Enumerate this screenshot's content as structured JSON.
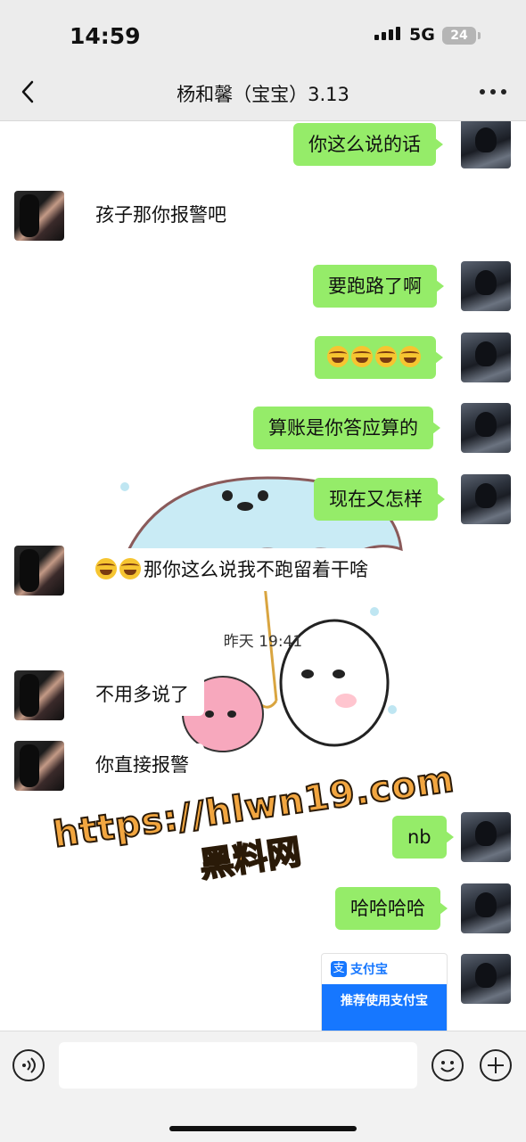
{
  "status_bar": {
    "time": "14:59",
    "network": "5G",
    "battery": "24"
  },
  "header": {
    "title": "杨和馨（宝宝）3.13",
    "back_icon": "chevron-left-icon",
    "more_icon": "more-dots-icon"
  },
  "messages": [
    {
      "side": "right",
      "text": "你这么说的话"
    },
    {
      "side": "left",
      "text": "孩子那你报警吧"
    },
    {
      "side": "right",
      "text": "要跑路了啊"
    },
    {
      "side": "right",
      "emoji_count": 4,
      "emoji": "laugh-cry-emoji"
    },
    {
      "side": "right",
      "text": "算账是你答应算的"
    },
    {
      "side": "right",
      "text": "现在又怎样"
    },
    {
      "side": "left",
      "prefix_emoji_count": 2,
      "text": "那你这么说我不跑留着干啥"
    },
    {
      "side": "left",
      "text": "不用多说了"
    },
    {
      "side": "left",
      "text": "你直接报警"
    },
    {
      "side": "right",
      "text": "nb"
    },
    {
      "side": "right",
      "text": "哈哈哈哈"
    }
  ],
  "timestamp": "昨天 19:41",
  "alipay_card": {
    "brand": "支付宝",
    "headline": "推荐使用支付宝",
    "icon": "支"
  },
  "watermark": {
    "url": "https://hlwn19.com",
    "name": "黑料网"
  },
  "input_bar": {
    "placeholder": "",
    "voice_icon": "voice-icon",
    "emoji_icon": "emoji-icon",
    "plus_icon": "plus-icon"
  }
}
